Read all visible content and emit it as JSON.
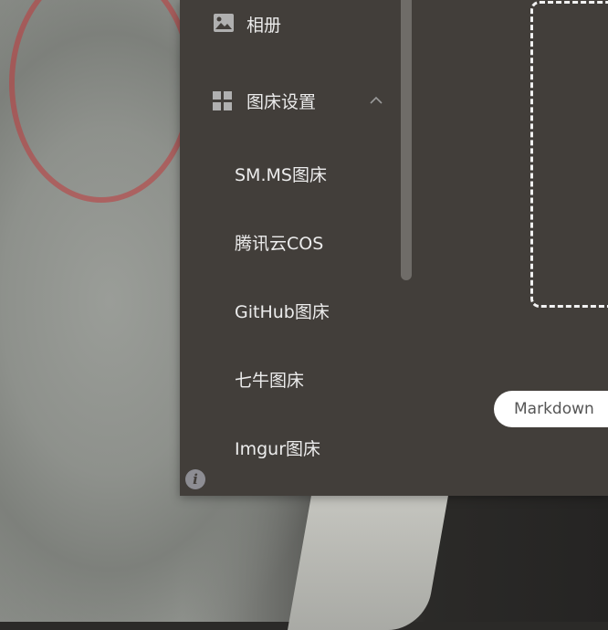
{
  "menu": {
    "album": {
      "label": "相册",
      "icon": "image-icon"
    },
    "image_host_settings": {
      "label": "图床设置",
      "icon": "grid-icon",
      "expanded": true
    },
    "sub_items": [
      {
        "label": "SM.MS图床"
      },
      {
        "label": "腾讯云COS"
      },
      {
        "label": "GitHub图床"
      },
      {
        "label": "七牛图床"
      },
      {
        "label": "Imgur图床"
      }
    ]
  },
  "upload": {
    "format_label": "Markdown"
  },
  "info": {
    "icon_glyph": "i"
  },
  "colors": {
    "drawer_bg": "#423e3a",
    "text": "#ececec",
    "icon": "#b0b0b0",
    "scrollbar": "#6f6c68"
  }
}
